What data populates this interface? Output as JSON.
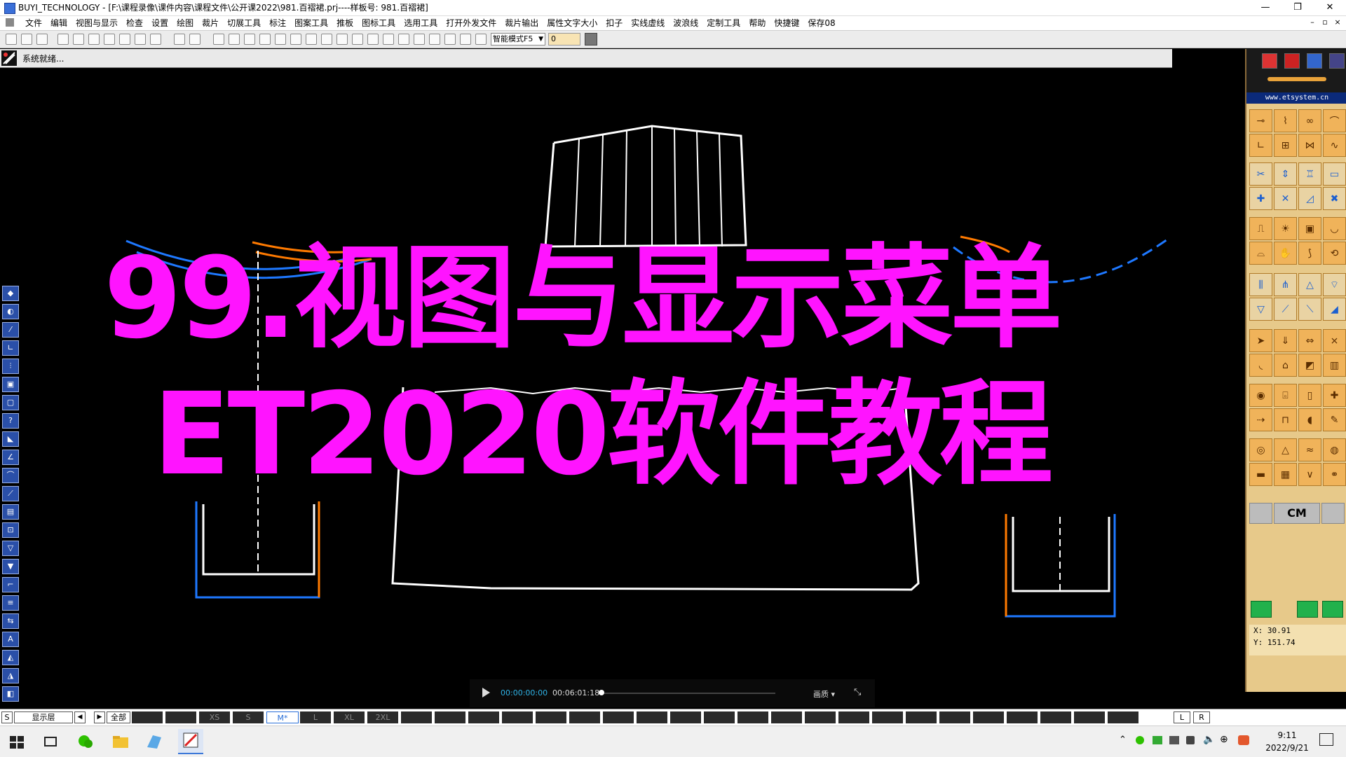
{
  "window": {
    "title": "BUYI_TECHNOLOGY - [F:\\课程录像\\课件内容\\课程文件\\公开课2022\\981.百褶裙.prj----样板号: 981.百褶裙]",
    "min": "—",
    "restore": "❐",
    "close": "✕"
  },
  "menu": {
    "items": [
      "文件",
      "编辑",
      "视图与显示",
      "检查",
      "设置",
      "绘图",
      "裁片",
      "切展工具",
      "标注",
      "图案工具",
      "推板",
      "图标工具",
      "选用工具",
      "打开外发文件",
      "裁片输出",
      "属性文字大小",
      "扣子",
      "实线虚线",
      "波浪线",
      "定制工具",
      "帮助",
      "快捷键",
      "保存08"
    ],
    "mdi_min": "–",
    "mdi_restore": "▫",
    "mdi_close": "×"
  },
  "toolbar": {
    "mode_select": "智能模式F5",
    "number_value": "0"
  },
  "status": {
    "message": "系统就绪..."
  },
  "right_panel": {
    "url": "www.etsystem.cn",
    "cm_label": "CM",
    "coords": {
      "x": "X:  30.91",
      "y": "Y:  151.74"
    }
  },
  "overlay": {
    "line1": "99.视图与显示菜单",
    "line2": "ET2020软件教程"
  },
  "video": {
    "current": "00:00:00:00",
    "total": "00:06:01:18",
    "quality": "画质",
    "quality_arrow": "▾",
    "expand": "⤡"
  },
  "size_bar": {
    "s_label": "S",
    "layer": "显示层",
    "left_arrow": "◀",
    "right_arrow": "▶",
    "all": "全部",
    "sizes": [
      "XS",
      "S",
      "M*",
      "L",
      "XL",
      "2XL"
    ],
    "active_size": "M*",
    "l_btn": "L",
    "r_btn": "R"
  },
  "taskbar": {
    "time": "9:11",
    "date": "2022/9/21"
  },
  "colors": {
    "overlay": "#ff14ff",
    "pattern_white": "#ffffff",
    "pattern_blue": "#1e78ff",
    "pattern_orange": "#ff7a00"
  }
}
